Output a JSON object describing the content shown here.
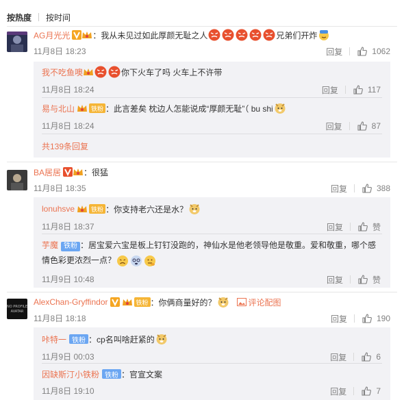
{
  "sort": {
    "hot": "按热度",
    "time": "按时间"
  },
  "reply_label": "回复",
  "zan_label": "赞",
  "comments": [
    {
      "user": "AG月光光",
      "text_a": "：我从未见过如此厚颜无耻之人",
      "text_b": "兄弟们开炸",
      "time": "11月8日 18:23",
      "likes": "1062",
      "replies": [
        {
          "user": "我不吃鱼噢",
          "text": "你下火车了吗 火车上不许带",
          "time": "11月8日 18:24",
          "likes": "117"
        },
        {
          "user": "易与北山",
          "fan": "铁粉",
          "text": "：此言差矣 枕边人怎能说成“厚颜无耻”（ bu shi",
          "time": "11月8日 18:24",
          "likes": "87"
        }
      ],
      "more": "共139条回复"
    },
    {
      "user": "BA居居",
      "text": "：很猛",
      "time": "11月8日 18:35",
      "likes": "388",
      "replies": [
        {
          "user": "lonuhsve",
          "fan": "铁粉",
          "text": "：你支持老六还是水？",
          "time": "11月8日 18:37",
          "likes": "赞"
        },
        {
          "user": "芋魔",
          "tie": "铁粉",
          "text": "：居宝爱六宝是板上钉钉没跑的，神仙水是他老领导他是敬重。爱和敬重，哪个感情色彩更浓烈一点？",
          "time": "11月9日 10:48",
          "likes": "赞"
        }
      ]
    },
    {
      "user": "AlexChan-Gryffindor",
      "fan": "铁粉",
      "text": "：你俩商量好的？",
      "img_link": "评论配图",
      "time": "11月8日 18:18",
      "likes": "190",
      "avatar_text": "NO PROFILE AVATAR",
      "replies": [
        {
          "user": "咔特一",
          "tie": "铁粉",
          "text": "：cp名叫啥赶紧的",
          "time": "11月9日 00:03",
          "likes": "6"
        },
        {
          "user": "因缺斯汀小铁粉",
          "tie": "铁粉",
          "text": "：官宣文案",
          "time": "11月8日 19:10",
          "likes": "7"
        }
      ]
    }
  ],
  "colors": {
    "username": "#eb7350",
    "time": "#808080",
    "subbox_bg": "#f2f2f5",
    "fan_badge": "#f5b536",
    "tie_badge": "#6ba6f2"
  }
}
